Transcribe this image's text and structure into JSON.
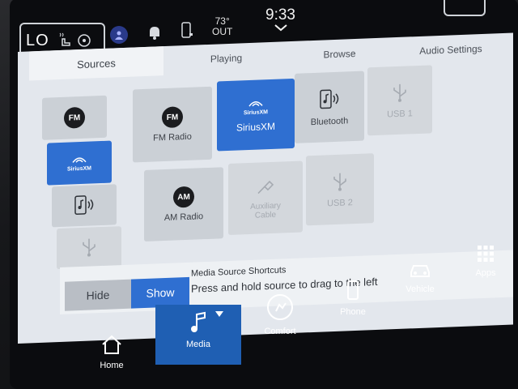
{
  "topbar": {
    "climate_mode": "LO",
    "temperature": "73°",
    "temperature_label": "OUT",
    "time": "9:33"
  },
  "tabs": [
    {
      "label": "Sources"
    },
    {
      "label": "Playing"
    },
    {
      "label": "Browse"
    },
    {
      "label": "Audio Settings"
    }
  ],
  "shortcuts": {
    "fm_logo": "FM",
    "sxm_logo": "SiriusXM"
  },
  "sources": {
    "fm": {
      "logo": "FM",
      "label": "FM Radio"
    },
    "sirius": {
      "logo": "SiriusXM",
      "label": "SiriusXM"
    },
    "bluetooth": {
      "label": "Bluetooth"
    },
    "usb1": {
      "label": "USB 1"
    },
    "am": {
      "logo": "AM",
      "label": "AM Radio"
    },
    "aux": {
      "label": "Auxiliary Cable"
    },
    "usb2": {
      "label": "USB 2"
    }
  },
  "shortcut_bar": {
    "title": "Media Source Shortcuts",
    "hint": "Press and hold source to drag to the left",
    "hide_label": "Hide",
    "show_label": "Show"
  },
  "nav": [
    {
      "label": "Home",
      "icon": "home-icon"
    },
    {
      "label": "Media",
      "icon": "music-note-icon"
    },
    {
      "label": "Comfort",
      "icon": "comfort-icon"
    },
    {
      "label": "Phone",
      "icon": "phone-icon"
    },
    {
      "label": "Vehicle",
      "icon": "car-icon"
    },
    {
      "label": "Apps",
      "icon": "apps-grid-icon"
    }
  ],
  "colors": {
    "accent": "#2f6fd1",
    "panel": "#e3e7ed",
    "tile": "#cbd0d6"
  }
}
